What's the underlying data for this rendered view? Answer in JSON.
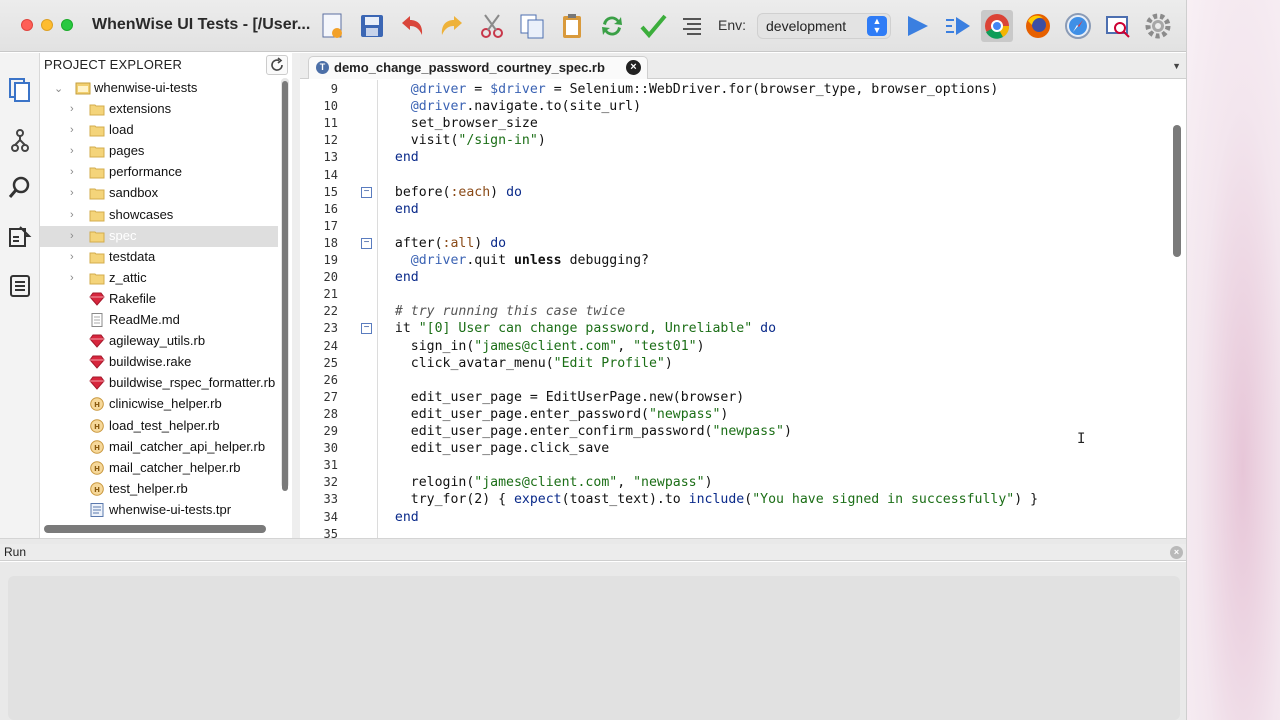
{
  "window": {
    "title": "WhenWise UI Tests - [/User..."
  },
  "toolbar": {
    "icons": [
      "new-file-icon",
      "save-icon",
      "undo-icon",
      "redo-icon",
      "cut-icon",
      "copy-icon",
      "paste-icon",
      "refresh-icon",
      "check-icon",
      "list-icon"
    ],
    "env_label": "Env:",
    "env_value": "development",
    "right_icons": [
      "run-icon",
      "run-selected-icon",
      "chrome-icon",
      "firefox-icon",
      "safari-icon",
      "inspect-icon",
      "settings-icon"
    ]
  },
  "explorer": {
    "header": "PROJECT EXPLORER",
    "root": "whenwise-ui-tests",
    "items": [
      {
        "label": "extensions",
        "type": "folder"
      },
      {
        "label": "load",
        "type": "folder"
      },
      {
        "label": "pages",
        "type": "folder"
      },
      {
        "label": "performance",
        "type": "folder"
      },
      {
        "label": "sandbox",
        "type": "folder"
      },
      {
        "label": "showcases",
        "type": "folder"
      },
      {
        "label": "spec",
        "type": "folder",
        "selected": true
      },
      {
        "label": "testdata",
        "type": "folder"
      },
      {
        "label": "z_attic",
        "type": "folder"
      },
      {
        "label": "Rakefile",
        "type": "ruby"
      },
      {
        "label": "ReadMe.md",
        "type": "doc"
      },
      {
        "label": "agileway_utils.rb",
        "type": "ruby"
      },
      {
        "label": "buildwise.rake",
        "type": "ruby"
      },
      {
        "label": "buildwise_rspec_formatter.rb",
        "type": "ruby"
      },
      {
        "label": "clinicwise_helper.rb",
        "type": "helper"
      },
      {
        "label": "load_test_helper.rb",
        "type": "helper"
      },
      {
        "label": "mail_catcher_api_helper.rb",
        "type": "helper"
      },
      {
        "label": "mail_catcher_helper.rb",
        "type": "helper"
      },
      {
        "label": "test_helper.rb",
        "type": "helper"
      },
      {
        "label": "whenwise-ui-tests.tpr",
        "type": "project"
      }
    ]
  },
  "editor": {
    "tab_label": "demo_change_password_courtney_spec.rb",
    "lines": [
      {
        "n": "9",
        "fold": false,
        "seg": [
          [
            "    ",
            ""
          ],
          [
            "@driver",
            "ivar"
          ],
          [
            " = ",
            ""
          ],
          [
            "$driver",
            "ivar"
          ],
          [
            " = Selenium::WebDriver.for(browser_type, browser_options)",
            ""
          ]
        ]
      },
      {
        "n": "10",
        "fold": false,
        "seg": [
          [
            "    ",
            ""
          ],
          [
            "@driver",
            "ivar"
          ],
          [
            ".navigate.to(site_url)",
            ""
          ]
        ]
      },
      {
        "n": "11",
        "fold": false,
        "seg": [
          [
            "    set_browser_size",
            ""
          ]
        ]
      },
      {
        "n": "12",
        "fold": false,
        "seg": [
          [
            "    visit(",
            ""
          ],
          [
            "\"/sign-in\"",
            "str"
          ],
          [
            ")",
            ""
          ]
        ]
      },
      {
        "n": "13",
        "fold": false,
        "seg": [
          [
            "  ",
            ""
          ],
          [
            "end",
            "kw"
          ]
        ]
      },
      {
        "n": "14",
        "fold": false,
        "seg": []
      },
      {
        "n": "15",
        "fold": true,
        "seg": [
          [
            "  before(",
            ""
          ],
          [
            ":each",
            "sym"
          ],
          [
            ") ",
            ""
          ],
          [
            "do",
            "kw"
          ]
        ]
      },
      {
        "n": "16",
        "fold": false,
        "seg": [
          [
            "  ",
            ""
          ],
          [
            "end",
            "kw"
          ]
        ]
      },
      {
        "n": "17",
        "fold": false,
        "seg": []
      },
      {
        "n": "18",
        "fold": true,
        "seg": [
          [
            "  after(",
            ""
          ],
          [
            ":all",
            "sym"
          ],
          [
            ") ",
            ""
          ],
          [
            "do",
            "kw"
          ]
        ]
      },
      {
        "n": "19",
        "fold": false,
        "seg": [
          [
            "    ",
            ""
          ],
          [
            "@driver",
            "ivar"
          ],
          [
            ".quit ",
            ""
          ],
          [
            "unless",
            "kwb"
          ],
          [
            " debugging?",
            ""
          ]
        ]
      },
      {
        "n": "20",
        "fold": false,
        "seg": [
          [
            "  ",
            ""
          ],
          [
            "end",
            "kw"
          ]
        ]
      },
      {
        "n": "21",
        "fold": false,
        "seg": []
      },
      {
        "n": "22",
        "fold": false,
        "seg": [
          [
            "  ",
            ""
          ],
          [
            "# try running this case twice",
            "cmt"
          ]
        ]
      },
      {
        "n": "23",
        "fold": true,
        "seg": [
          [
            "  it ",
            ""
          ],
          [
            "\"[0] User can change password, Unreliable\"",
            "str"
          ],
          [
            " ",
            ""
          ],
          [
            "do",
            "kw"
          ]
        ]
      },
      {
        "n": "24",
        "fold": false,
        "seg": [
          [
            "    sign_in(",
            ""
          ],
          [
            "\"james@client.com\"",
            "str"
          ],
          [
            ", ",
            ""
          ],
          [
            "\"test01\"",
            "str"
          ],
          [
            ")",
            ""
          ]
        ]
      },
      {
        "n": "25",
        "fold": false,
        "seg": [
          [
            "    click_avatar_menu(",
            ""
          ],
          [
            "\"Edit Profile\"",
            "str"
          ],
          [
            ")",
            ""
          ]
        ]
      },
      {
        "n": "26",
        "fold": false,
        "seg": []
      },
      {
        "n": "27",
        "fold": false,
        "seg": [
          [
            "    edit_user_page = EditUserPage.new(browser)",
            ""
          ]
        ]
      },
      {
        "n": "28",
        "fold": false,
        "seg": [
          [
            "    edit_user_page.enter_password(",
            ""
          ],
          [
            "\"newpass\"",
            "str"
          ],
          [
            ")",
            ""
          ]
        ]
      },
      {
        "n": "29",
        "fold": false,
        "seg": [
          [
            "    edit_user_page.enter_confirm_password(",
            ""
          ],
          [
            "\"newpass\"",
            "str"
          ],
          [
            ")",
            ""
          ]
        ]
      },
      {
        "n": "30",
        "fold": false,
        "seg": [
          [
            "    edit_user_page.click_save",
            ""
          ]
        ]
      },
      {
        "n": "31",
        "fold": false,
        "seg": []
      },
      {
        "n": "32",
        "fold": false,
        "seg": [
          [
            "    relogin(",
            ""
          ],
          [
            "\"james@client.com\"",
            "str"
          ],
          [
            ", ",
            ""
          ],
          [
            "\"newpass\"",
            "str"
          ],
          [
            ")",
            ""
          ]
        ]
      },
      {
        "n": "33",
        "fold": false,
        "seg": [
          [
            "    try_for(2) { ",
            ""
          ],
          [
            "expect",
            "kw"
          ],
          [
            "(toast_text).to ",
            ""
          ],
          [
            "include",
            "kw"
          ],
          [
            "(",
            ""
          ],
          [
            "\"You have signed in successfully\"",
            "str"
          ],
          [
            ") }",
            ""
          ]
        ]
      },
      {
        "n": "34",
        "fold": false,
        "seg": [
          [
            "  ",
            ""
          ],
          [
            "end",
            "kw"
          ]
        ]
      },
      {
        "n": "35",
        "fold": false,
        "seg": []
      }
    ]
  },
  "run_panel": {
    "title": "Run"
  }
}
